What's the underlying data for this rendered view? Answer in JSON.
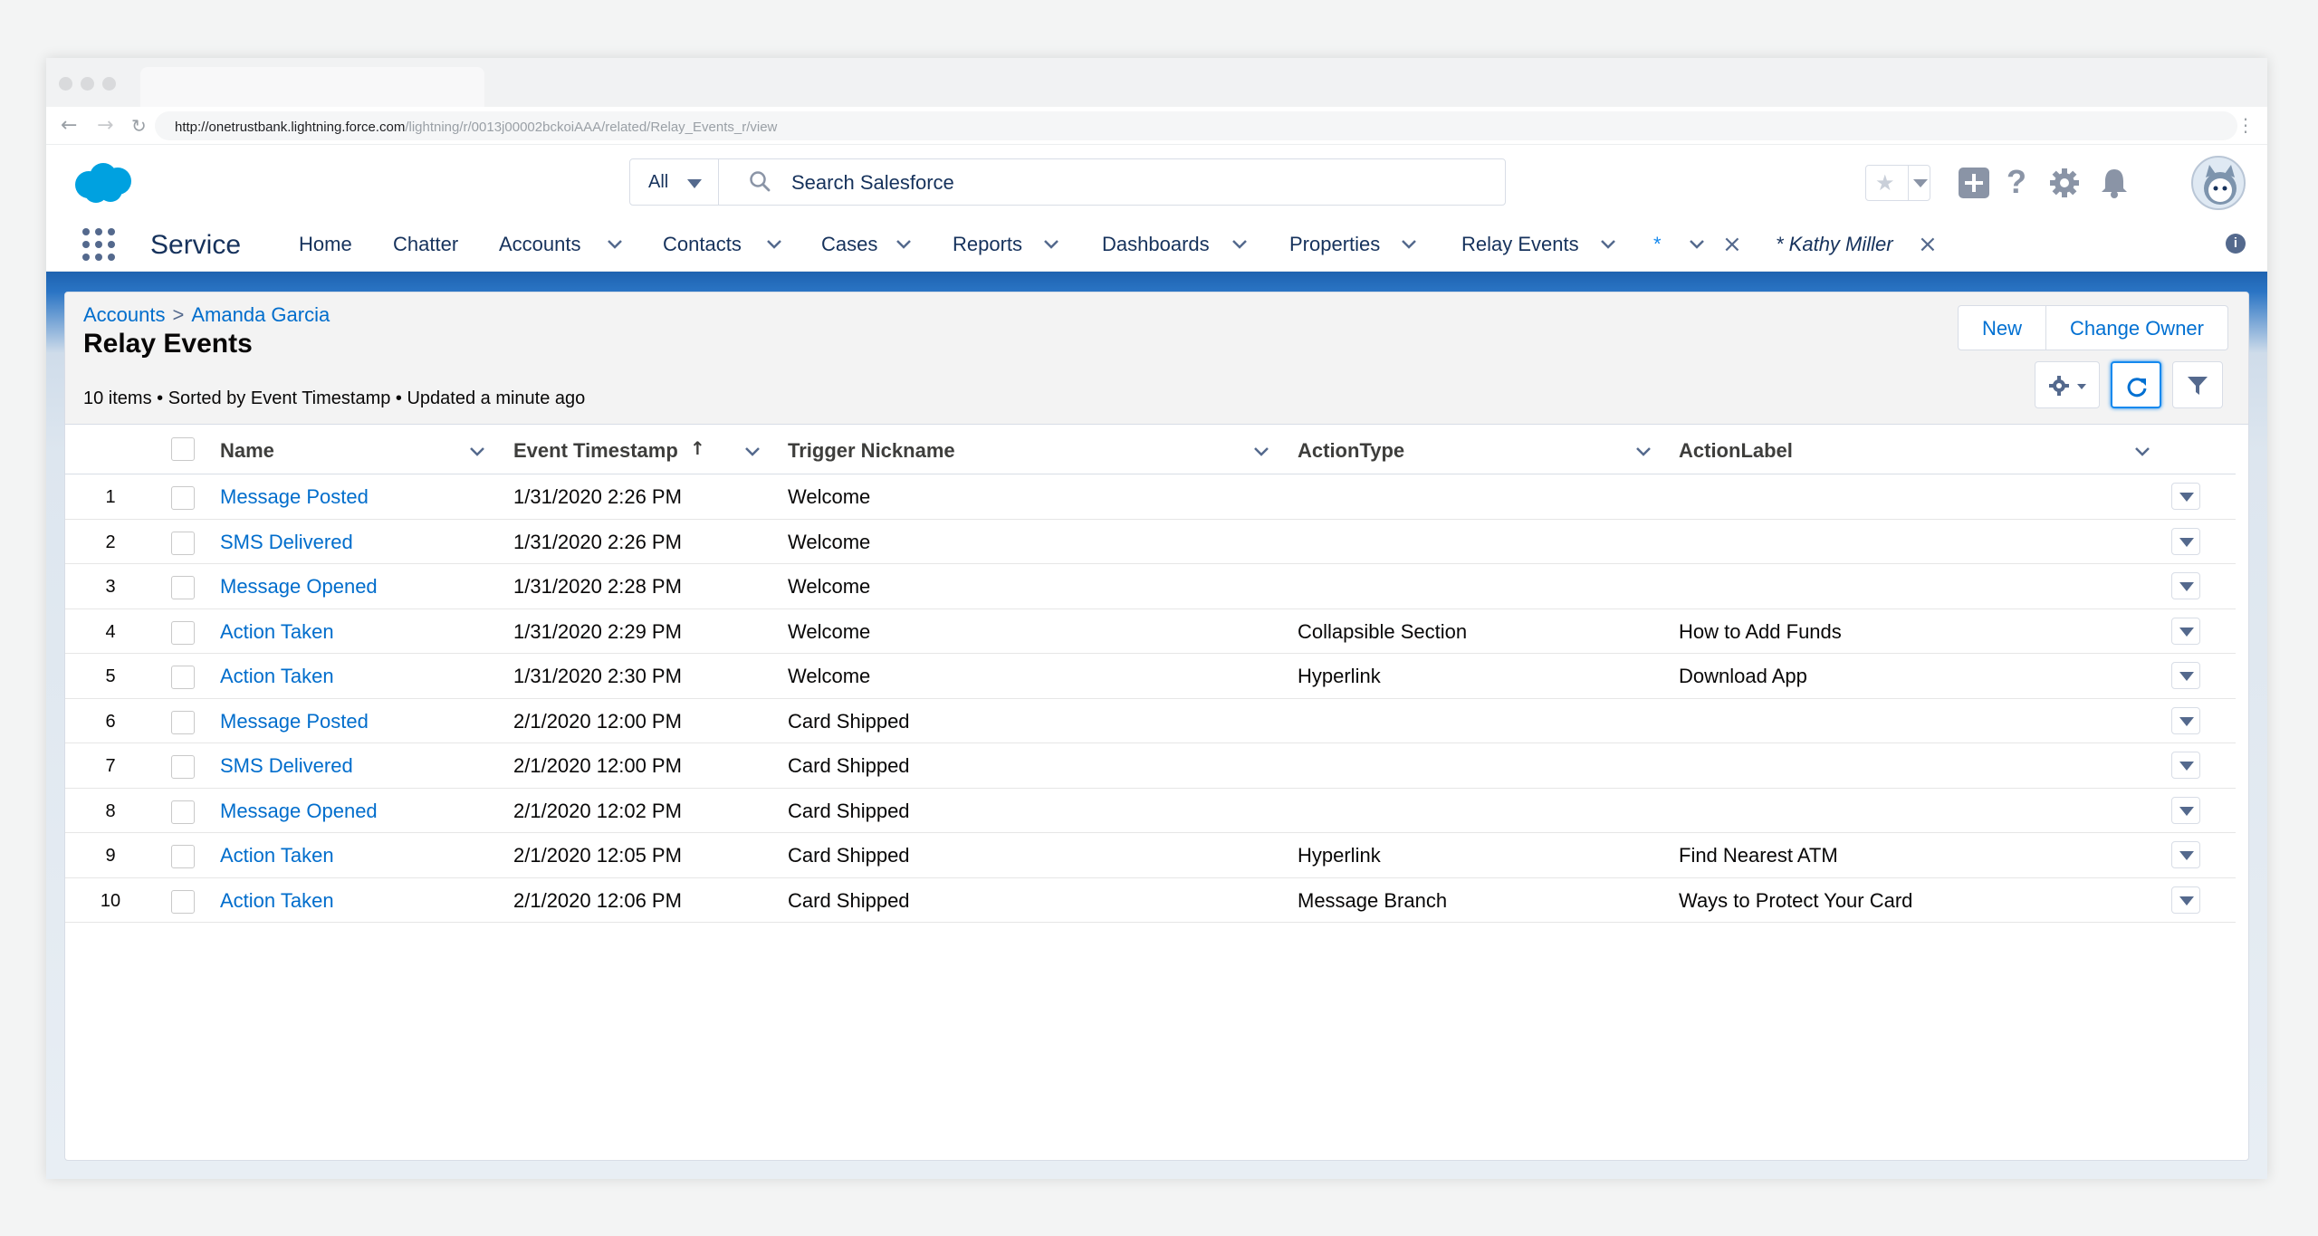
{
  "browser": {
    "url_main": "http://onetrustbank.lightning.force.com",
    "url_path": "/lightning/r/0013j00002bckoiAAA/related/Relay_Events_r/view"
  },
  "header": {
    "search_scope": "All",
    "search_placeholder": "Search Salesforce"
  },
  "nav": {
    "app_name": "Service",
    "items": [
      {
        "label": "Home"
      },
      {
        "label": "Chatter"
      },
      {
        "label": "Accounts"
      },
      {
        "label": "Contacts"
      },
      {
        "label": "Cases"
      },
      {
        "label": "Reports"
      },
      {
        "label": "Dashboards"
      },
      {
        "label": "Properties"
      },
      {
        "label": "Relay Events"
      },
      {
        "label": "*"
      },
      {
        "label": "* Kathy Miller"
      }
    ]
  },
  "page": {
    "breadcrumb": [
      "Accounts",
      "Amanda Garcia"
    ],
    "breadcrumb_sep": ">",
    "title": "Relay Events",
    "meta": "10 items • Sorted by Event Timestamp • Updated a minute ago",
    "buttons": {
      "new": "New",
      "change_owner": "Change Owner"
    }
  },
  "table": {
    "columns": [
      "Name",
      "Event Timestamp",
      "Trigger Nickname",
      "ActionType",
      "ActionLabel"
    ],
    "sort_indicator": "↑",
    "rows": [
      {
        "num": "1",
        "name": "Message Posted",
        "timestamp": "1/31/2020 2:26 PM",
        "trigger": "Welcome",
        "action_type": "",
        "action_label": ""
      },
      {
        "num": "2",
        "name": "SMS Delivered",
        "timestamp": "1/31/2020 2:26 PM",
        "trigger": "Welcome",
        "action_type": "",
        "action_label": ""
      },
      {
        "num": "3",
        "name": "Message Opened",
        "timestamp": "1/31/2020 2:28 PM",
        "trigger": "Welcome",
        "action_type": "",
        "action_label": ""
      },
      {
        "num": "4",
        "name": "Action Taken",
        "timestamp": "1/31/2020 2:29 PM",
        "trigger": "Welcome",
        "action_type": "Collapsible Section",
        "action_label": "How to Add Funds"
      },
      {
        "num": "5",
        "name": "Action Taken",
        "timestamp": "1/31/2020 2:30 PM",
        "trigger": "Welcome",
        "action_type": "Hyperlink",
        "action_label": "Download App"
      },
      {
        "num": "6",
        "name": "Message Posted",
        "timestamp": "2/1/2020 12:00 PM",
        "trigger": "Card Shipped",
        "action_type": "",
        "action_label": ""
      },
      {
        "num": "7",
        "name": "SMS Delivered",
        "timestamp": "2/1/2020 12:00 PM",
        "trigger": "Card Shipped",
        "action_type": "",
        "action_label": ""
      },
      {
        "num": "8",
        "name": "Message Opened",
        "timestamp": "2/1/2020 12:02 PM",
        "trigger": "Card Shipped",
        "action_type": "",
        "action_label": ""
      },
      {
        "num": "9",
        "name": "Action Taken",
        "timestamp": "2/1/2020 12:05 PM",
        "trigger": "Card Shipped",
        "action_type": "Hyperlink",
        "action_label": "Find Nearest ATM"
      },
      {
        "num": "10",
        "name": "Action Taken",
        "timestamp": "2/1/2020 12:06 PM",
        "trigger": "Card Shipped",
        "action_type": "Message Branch",
        "action_label": "Ways to Protect Your Card"
      }
    ]
  },
  "colors": {
    "brand_blue": "#1e63b0",
    "link_blue": "#006dcc",
    "logo_blue": "#00a1e0"
  },
  "icons": [
    "back-icon",
    "forward-icon",
    "reload-icon",
    "salesforce-logo",
    "search-icon",
    "star-icon",
    "add-icon",
    "help-icon",
    "setup-gear-icon",
    "bell-icon",
    "avatar",
    "app-launcher-icon",
    "close-icon",
    "info-icon",
    "settings-gear-icon",
    "refresh-icon",
    "filter-icon"
  ]
}
